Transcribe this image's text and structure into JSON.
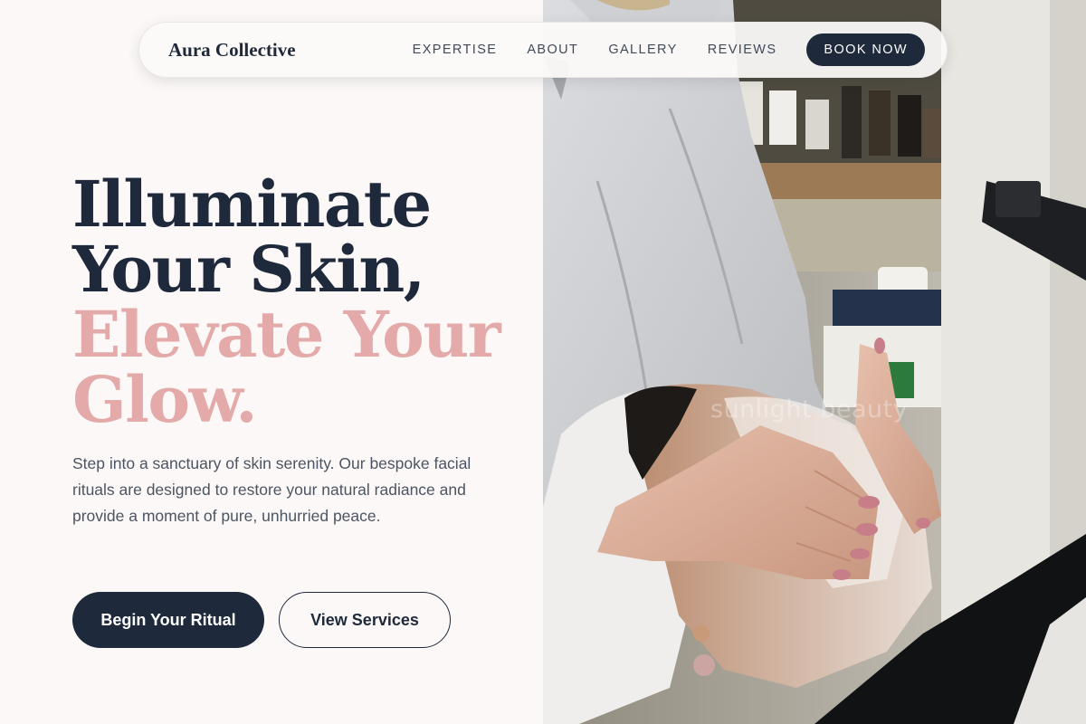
{
  "nav": {
    "brand": "Aura Collective",
    "links": [
      "EXPERTISE",
      "ABOUT",
      "GALLERY",
      "REVIEWS"
    ],
    "cta": "BOOK NOW"
  },
  "hero": {
    "title_lines": [
      "Illuminate",
      "Your Skin,"
    ],
    "accent_lines": [
      "Elevate Your",
      "Glow."
    ],
    "description": "Step into a sanctuary of skin serenity. Our bespoke facial rituals are designed to restore your natural radiance and provide a moment of pure, unhurried peace.",
    "primary_button": "Begin Your Ritual",
    "secondary_button": "View Services"
  },
  "image": {
    "watermark": "sunlight beauty"
  },
  "colors": {
    "navy": "#1e293b",
    "accent_pink": "#e4aaaa",
    "page_background": "#fcf8f7",
    "body_text": "#4b5563"
  }
}
